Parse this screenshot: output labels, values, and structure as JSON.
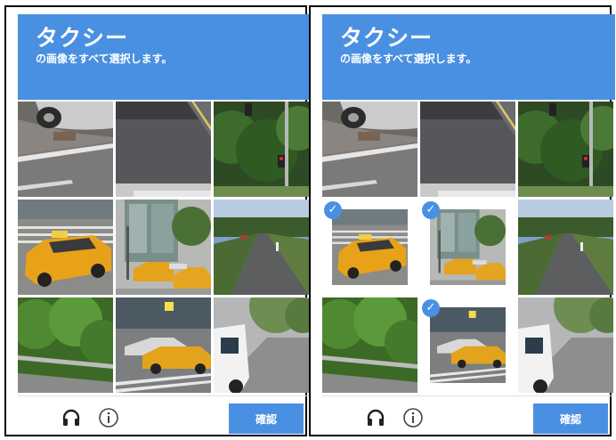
{
  "header": {
    "title": "タクシー",
    "subtitle": "の画像をすべて選択します。"
  },
  "footer": {
    "verify_label": "確認",
    "audio_icon": "headphones-icon",
    "info_icon": "info-icon"
  },
  "colors": {
    "accent": "#4a90e2"
  },
  "panels": [
    {
      "name": "before",
      "tiles": [
        {
          "scene": "car-bumper-curb",
          "selected": false
        },
        {
          "scene": "asphalt-road",
          "selected": false
        },
        {
          "scene": "trees-traffic-light",
          "selected": false
        },
        {
          "scene": "yellow-taxi-crosswalk",
          "selected": false
        },
        {
          "scene": "taxis-building",
          "selected": false
        },
        {
          "scene": "highway-trees",
          "selected": false
        },
        {
          "scene": "bushes-guardrail",
          "selected": false
        },
        {
          "scene": "taxi-street-crosswalk",
          "selected": false
        },
        {
          "scene": "white-van-road",
          "selected": false
        }
      ]
    },
    {
      "name": "after",
      "tiles": [
        {
          "scene": "car-bumper-curb",
          "selected": false
        },
        {
          "scene": "asphalt-road",
          "selected": false
        },
        {
          "scene": "trees-traffic-light",
          "selected": false
        },
        {
          "scene": "yellow-taxi-crosswalk",
          "selected": true
        },
        {
          "scene": "taxis-building",
          "selected": true
        },
        {
          "scene": "highway-trees",
          "selected": false
        },
        {
          "scene": "bushes-guardrail",
          "selected": false
        },
        {
          "scene": "taxi-street-crosswalk",
          "selected": true
        },
        {
          "scene": "white-van-road",
          "selected": false
        }
      ]
    }
  ]
}
